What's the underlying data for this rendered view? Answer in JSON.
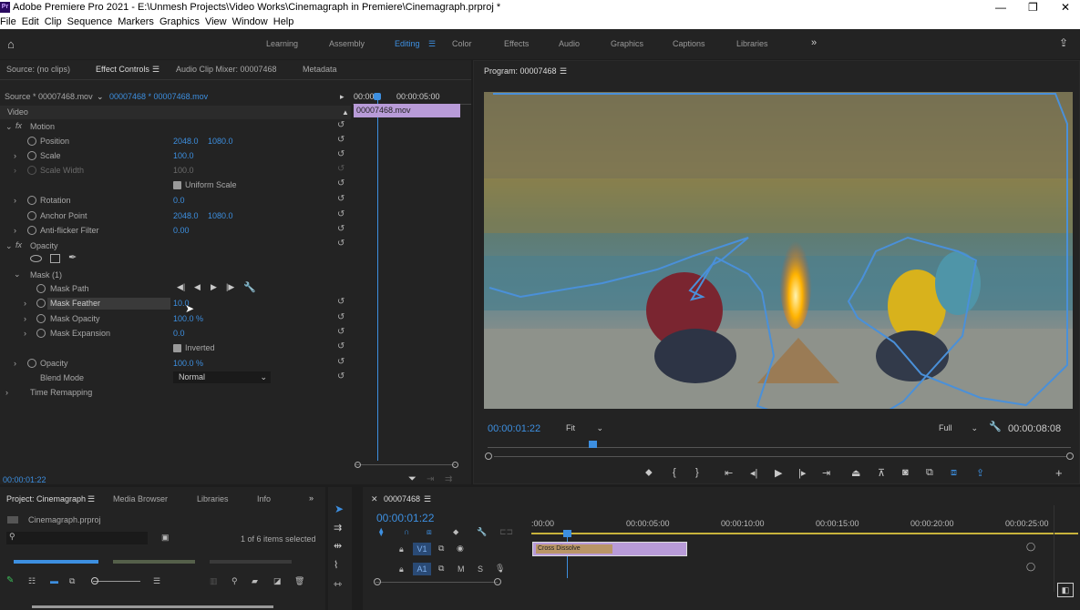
{
  "window": {
    "title": "Adobe Premiere Pro 2021 - E:\\Unmesh Projects\\Video Works\\Cinemagraph in Premiere\\Cinemagraph.prproj *",
    "logo": "Pr",
    "minimize": "—",
    "maximize": "❐",
    "close": "✕"
  },
  "menu": [
    "File",
    "Edit",
    "Clip",
    "Sequence",
    "Markers",
    "Graphics",
    "View",
    "Window",
    "Help"
  ],
  "workspaces": [
    "Learning",
    "Assembly",
    "Editing",
    "Color",
    "Effects",
    "Audio",
    "Graphics",
    "Captions",
    "Libraries"
  ],
  "source_panel": {
    "tabs": [
      "Source: (no clips)",
      "Effect Controls",
      "Audio Clip Mixer: 00007468",
      "Metadata"
    ],
    "source_clip": "Source * 00007468.mov",
    "seq_clip": "00007468 * 00007468.mov",
    "timecodes": [
      "00:00",
      "00:00:05:00"
    ],
    "clip_bar": "00007468.mov",
    "section": "Video",
    "time": "00:00:01:22"
  },
  "effects": {
    "motion": "Motion",
    "position": {
      "label": "Position",
      "x": "2048.0",
      "y": "1080.0"
    },
    "scale": {
      "label": "Scale",
      "value": "100.0"
    },
    "scale_width": {
      "label": "Scale Width",
      "value": "100.0"
    },
    "uniform": "Uniform Scale",
    "rotation": {
      "label": "Rotation",
      "value": "0.0"
    },
    "anchor": {
      "label": "Anchor Point",
      "x": "2048.0",
      "y": "1080.0"
    },
    "antiflicker": {
      "label": "Anti-flicker Filter",
      "value": "0.00"
    },
    "opacity_group": "Opacity",
    "mask": "Mask (1)",
    "mask_path": "Mask Path",
    "mask_feather": {
      "label": "Mask Feather",
      "value": "10.0"
    },
    "mask_opacity": {
      "label": "Mask Opacity",
      "value": "100.0 %"
    },
    "mask_expansion": {
      "label": "Mask Expansion",
      "value": "0.0"
    },
    "inverted": "Inverted",
    "opacity": {
      "label": "Opacity",
      "value": "100.0 %"
    },
    "blend": {
      "label": "Blend Mode",
      "value": "Normal"
    },
    "time_remap": "Time Remapping"
  },
  "program": {
    "title": "Program: 00007468",
    "timecode": "00:00:01:22",
    "fit": "Fit",
    "quality": "Full",
    "duration": "00:00:08:08",
    "playhead_fraction": 0.18
  },
  "project": {
    "tabs": [
      "Project: Cinemagraph",
      "Media Browser",
      "Libraries",
      "Info"
    ],
    "file": "Cinemagraph.prproj",
    "items": "1 of 6 items selected"
  },
  "timeline": {
    "tab": "00007468",
    "timecode": "00:00:01:22",
    "ruler": [
      ":00:00",
      "00:00:05:00",
      "00:00:10:00",
      "00:00:15:00",
      "00:00:20:00",
      "00:00:25:00"
    ],
    "v1": "V1",
    "a1": "A1",
    "transition": "Cross Dissolve",
    "m": "M",
    "s": "S"
  },
  "colors": {
    "accent": "#3d8fe0",
    "clip": "#b89bd8",
    "panel": "#232323"
  }
}
